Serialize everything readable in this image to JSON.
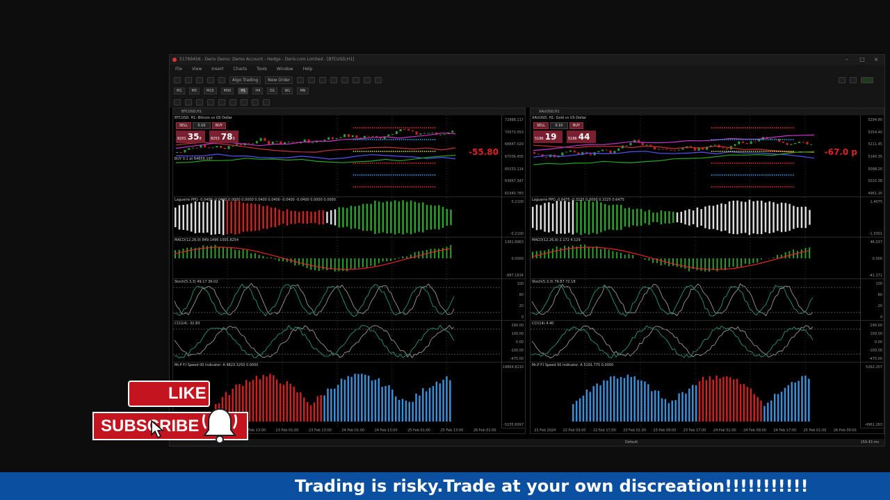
{
  "window": {
    "title": "51769456 - Deriv Demo: Demo Account - Hedge - Deriv.com Limited - [BTCUSD,H1]",
    "menu": [
      "File",
      "View",
      "Insert",
      "Charts",
      "Tools",
      "Window",
      "Help"
    ],
    "toolbar": {
      "algo_trading": "Algo Trading",
      "new_order": "New Order"
    },
    "timeframes": [
      "M1",
      "M5",
      "M15",
      "M30",
      "H1",
      "H4",
      "D1",
      "W1",
      "MN"
    ],
    "active_timeframe": "H1",
    "status_profile": "Default",
    "status_speed": "159.43 ms"
  },
  "left_chart": {
    "tab_title": "BTCUSD,H1",
    "symbol_label": "BTCUSD, H1: Bitcoin vs US Dollar",
    "sell_label": "SELL",
    "buy_label": "BUY",
    "lot": "0.10",
    "sell_price_prefix": "8201",
    "sell_price_main": "35",
    "sell_price_sup": "8",
    "buy_price_prefix": "8253",
    "buy_price_main": "78",
    "buy_price_sup": "3",
    "order_label": "BUY 0.1 at 64656.197",
    "red_value": "-55.80",
    "pane_labels": {
      "ppo": "Laguerre PPO -0.0400 -0.0400 0.0000 0.0000 0.0400 0.0400 -0.0400 -0.0400 0.0000 0.0000",
      "macd": "MACD(12,26,9) 849.1496 1005.8254",
      "stoch": "Stoch(5,3,3) 49.17 36.02",
      "cci": "CCI(14) -32.83",
      "speed": "Mr.P F.I Speed 00 Indicator: A 4823.3250 0.0000"
    },
    "y_ticks_main": [
      "72888.117",
      "70573.553",
      "68847.029",
      "67036.455",
      "65233.114",
      "63667.347",
      "61940.783"
    ],
    "y_ticks_ppo": [
      "0.2100",
      "-0.2100"
    ],
    "y_ticks_macd": [
      "1361.8963",
      "0.0000",
      "-887.1634"
    ],
    "y_ticks_stoch": [
      "100",
      "80",
      "20",
      "0"
    ],
    "y_ticks_cci": [
      "290.00",
      "100.00",
      "0.00",
      "-100.00",
      "-475.00"
    ],
    "y_ticks_speed": [
      "19864.8210",
      "-5235.6997"
    ],
    "x_labels": [
      "21 Feb 2024",
      "22 Feb 01:00",
      "22 Feb 13:00",
      "23 Feb 01:00",
      "23 Feb 13:00",
      "24 Feb 01:00",
      "24 Feb 13:00",
      "25 Feb 01:00",
      "25 Feb 13:00",
      "26 Feb 01:00"
    ]
  },
  "right_chart": {
    "tab_title": "XAUUSD,H1",
    "symbol_label": "XAUUSD, H1: Gold vs US Dollar",
    "sell_label": "SELL",
    "buy_label": "BUY",
    "lot": "0.10",
    "sell_price_prefix": "5186",
    "sell_price_main": "19",
    "buy_price_prefix": "5186",
    "buy_price_main": "44",
    "red_value": "-67.0 p",
    "pane_labels": {
      "ppo": "Laguerre PPO -0.6475 -0.3225 0.0000 0.3225 0.6475",
      "macd": "MACD(12,26,9) 2.172 4.129",
      "stoch": "Stoch(5,3,3) 79.87 72.18",
      "cci": "CCI(14) 4.40",
      "speed": "Mr.P F.I Speed 00 Indicator: A 5191.775 0.0000"
    },
    "y_ticks_main": [
      "5294.80",
      "5254.40",
      "5211.45",
      "5140.35",
      "5098.20",
      "5015.38",
      "4961.25"
    ],
    "y_ticks_ppo": [
      "1.4075",
      "-1.3301"
    ],
    "y_ticks_macd": [
      "46.037",
      "0.000",
      "-41.271"
    ],
    "y_ticks_stoch": [
      "100",
      "80",
      "20",
      "0"
    ],
    "y_ticks_cci": [
      "290.00",
      "100.00",
      "0.00",
      "-100.00",
      "-475.00"
    ],
    "y_ticks_speed": [
      "5262.207",
      "-4961.263"
    ],
    "x_labels": [
      "21 Feb 2024",
      "22 Feb 09:00",
      "22 Feb 17:00",
      "23 Feb 01:00",
      "23 Feb 09:00",
      "23 Feb 17:00",
      "24 Feb 01:00",
      "24 Feb 09:00",
      "24 Feb 17:00",
      "25 Feb 01:00",
      "26 Feb 09:00"
    ]
  },
  "overlay": {
    "like": "LIKE",
    "subscribe": "SUBSCRIBE",
    "banner": "Trading is risky.Trade at your own discreation!!!!!!!!!!!"
  },
  "colors": {
    "bull": "#2ea02e",
    "bear": "#cc2222",
    "blue_bar": "#3b8fd6",
    "banner": "#0a4fa0",
    "subscribe": "#c41420"
  }
}
